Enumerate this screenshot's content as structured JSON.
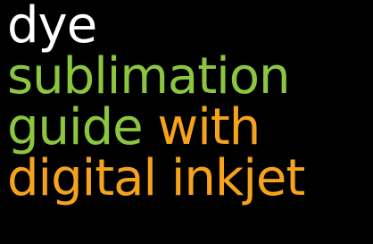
{
  "title": {
    "line1": {
      "white": "dye"
    },
    "line2": {
      "green": "sublimation"
    },
    "line3": {
      "green": "guide ",
      "orange": "with"
    },
    "line4": {
      "orange": "digital inkjet"
    }
  },
  "colors": {
    "background": "#000000",
    "white": "#ffffff",
    "green": "#8cc63f",
    "orange": "#f6a21c"
  }
}
